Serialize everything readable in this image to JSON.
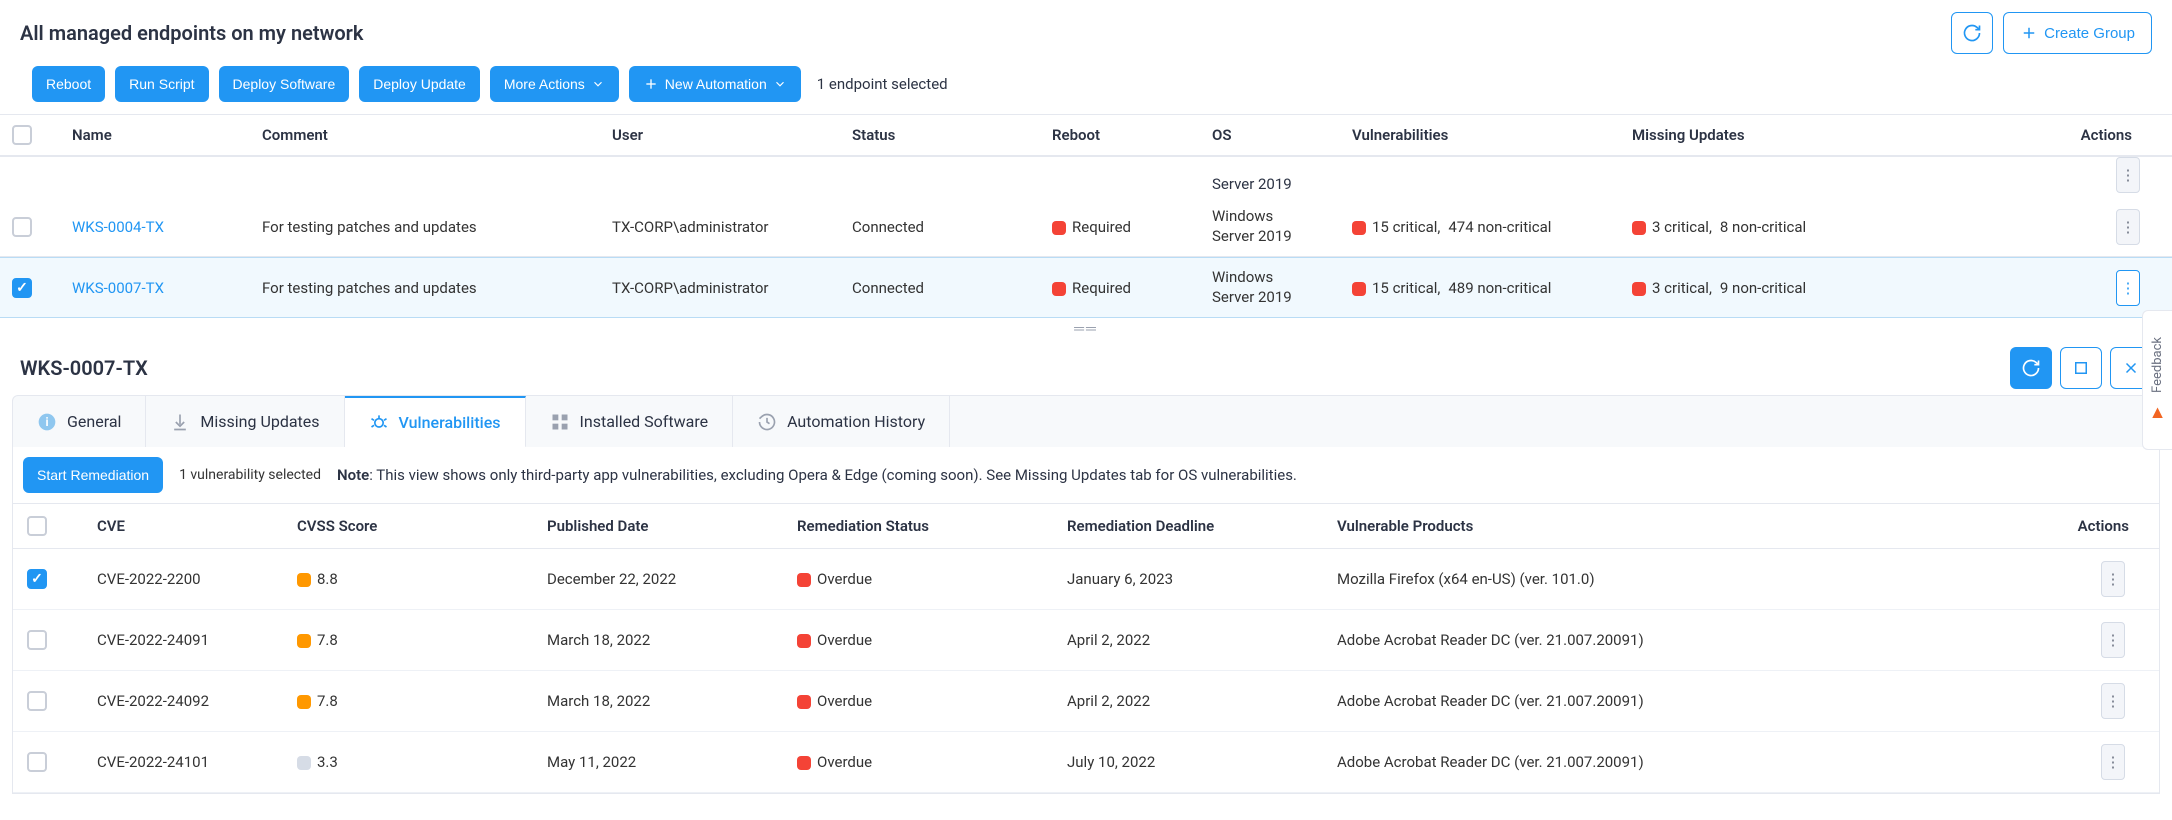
{
  "header": {
    "title": "All managed endpoints on my network",
    "create_group": "Create Group"
  },
  "toolbar": {
    "reboot": "Reboot",
    "run_script": "Run Script",
    "deploy_software": "Deploy Software",
    "deploy_update": "Deploy Update",
    "more_actions": "More Actions",
    "new_automation": "New Automation",
    "selection": "1 endpoint selected"
  },
  "columns": {
    "name": "Name",
    "comment": "Comment",
    "user": "User",
    "status": "Status",
    "reboot": "Reboot",
    "os": "OS",
    "vulnerabilities": "Vulnerabilities",
    "missing_updates": "Missing Updates",
    "actions": "Actions"
  },
  "partial_row": {
    "os": "Server 2019"
  },
  "rows": [
    {
      "selected": false,
      "name": "WKS-0004-TX",
      "comment": "For testing patches and updates",
      "user": "TX-CORP\\administrator",
      "status": "Connected",
      "reboot": "Required",
      "os_line1": "Windows",
      "os_line2": "Server 2019",
      "vuln_crit": "15 critical,",
      "vuln_non": "474 non-critical",
      "upd_crit": "3 critical,",
      "upd_non": "8 non-critical"
    },
    {
      "selected": true,
      "name": "WKS-0007-TX",
      "comment": "For testing patches and updates",
      "user": "TX-CORP\\administrator",
      "status": "Connected",
      "reboot": "Required",
      "os_line1": "Windows",
      "os_line2": "Server 2019",
      "vuln_crit": "15 critical,",
      "vuln_non": "489 non-critical",
      "upd_crit": "3 critical,",
      "upd_non": "9 non-critical"
    }
  ],
  "detail": {
    "title": "WKS-0007-TX",
    "tabs": {
      "general": "General",
      "missing_updates": "Missing Updates",
      "vulnerabilities": "Vulnerabilities",
      "installed_software": "Installed Software",
      "automation_history": "Automation History"
    },
    "sub": {
      "start_remediation": "Start Remediation",
      "selection": "1 vulnerability selected",
      "note_label": "Note",
      "note_text": ": This view shows only third-party app vulnerabilities, excluding Opera & Edge (coming soon). See Missing Updates tab for OS vulnerabilities."
    },
    "vcolumns": {
      "cve": "CVE",
      "cvss": "CVSS Score",
      "published": "Published Date",
      "rstatus": "Remediation Status",
      "rdeadline": "Remediation Deadline",
      "products": "Vulnerable Products",
      "actions": "Actions"
    },
    "vrows": [
      {
        "selected": true,
        "cve": "CVE-2022-2200",
        "score": "8.8",
        "score_level": "orange",
        "published": "December 22, 2022",
        "status": "Overdue",
        "deadline": "January 6, 2023",
        "product": "Mozilla Firefox (x64 en-US) (ver. 101.0)"
      },
      {
        "selected": false,
        "cve": "CVE-2022-24091",
        "score": "7.8",
        "score_level": "orange",
        "published": "March 18, 2022",
        "status": "Overdue",
        "deadline": "April 2, 2022",
        "product": "Adobe Acrobat Reader DC (ver. 21.007.20091)"
      },
      {
        "selected": false,
        "cve": "CVE-2022-24092",
        "score": "7.8",
        "score_level": "orange",
        "published": "March 18, 2022",
        "status": "Overdue",
        "deadline": "April 2, 2022",
        "product": "Adobe Acrobat Reader DC (ver. 21.007.20091)"
      },
      {
        "selected": false,
        "cve": "CVE-2022-24101",
        "score": "3.3",
        "score_level": "grey",
        "published": "May 11, 2022",
        "status": "Overdue",
        "deadline": "July 10, 2022",
        "product": "Adobe Acrobat Reader DC (ver. 21.007.20091)"
      }
    ]
  },
  "feedback": "Feedback"
}
